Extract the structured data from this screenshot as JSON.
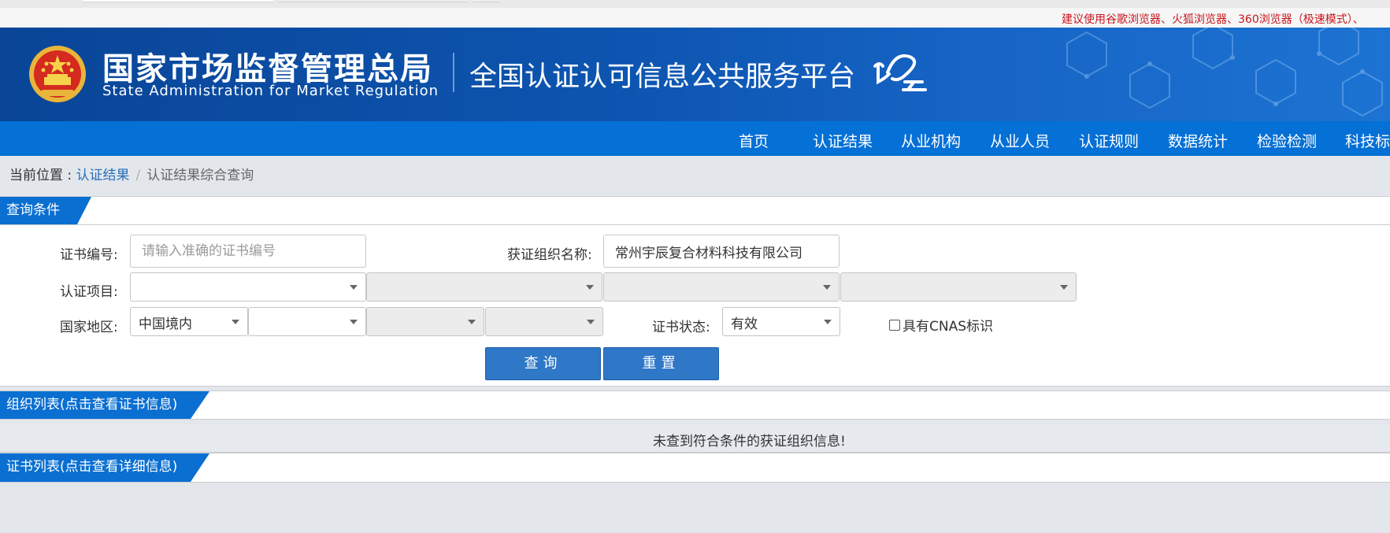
{
  "notice": {
    "text": "建议使用谷歌浏览器、火狐浏览器、360浏览器（极速模式）、"
  },
  "header": {
    "agency_cn": "国家市场监督管理总局",
    "agency_en": "State Administration  for  Market Regulation",
    "platform_title": "全国认证认可信息公共服务平台",
    "logo_text": "认e云"
  },
  "nav": {
    "items": [
      {
        "label": "首页"
      },
      {
        "label": "认证结果"
      },
      {
        "label": "从业机构"
      },
      {
        "label": "从业人员"
      },
      {
        "label": "认证规则"
      },
      {
        "label": "数据统计"
      },
      {
        "label": "检验检测"
      },
      {
        "label": "科技标"
      }
    ]
  },
  "breadcrumb": {
    "prefix": "当前位置 : ",
    "link": "认证结果",
    "separator": "/",
    "current": "认证结果综合查询"
  },
  "query_panel": {
    "title": "查询条件",
    "cert_no": {
      "label": "证书编号:",
      "placeholder": "请输入准确的证书编号",
      "value": ""
    },
    "org_name": {
      "label": "获证组织名称:",
      "value": "常州宇辰复合材料科技有限公司"
    },
    "cert_item": {
      "label": "认证项目:",
      "selects": [
        "",
        "",
        "",
        ""
      ]
    },
    "region": {
      "label": "国家地区:",
      "selects": [
        "中国境内",
        "",
        "",
        ""
      ]
    },
    "status": {
      "label": "证书状态:",
      "value": "有效"
    },
    "cnas": {
      "label": "具有CNAS标识",
      "checked": false
    },
    "search_button": "查询",
    "reset_button": "重置"
  },
  "org_list": {
    "title": "组织列表(点击查看证书信息)",
    "empty_message": "未查到符合条件的获证组织信息!"
  },
  "cert_list": {
    "title": "证书列表(点击查看详细信息)"
  },
  "colors": {
    "header_blue": "#0a4597",
    "nav_blue": "#0570d6",
    "tab_blue": "#0a6fd1",
    "button_blue": "#2f77c7",
    "notice_red": "#c8161d",
    "link_blue": "#2a6fb8"
  }
}
